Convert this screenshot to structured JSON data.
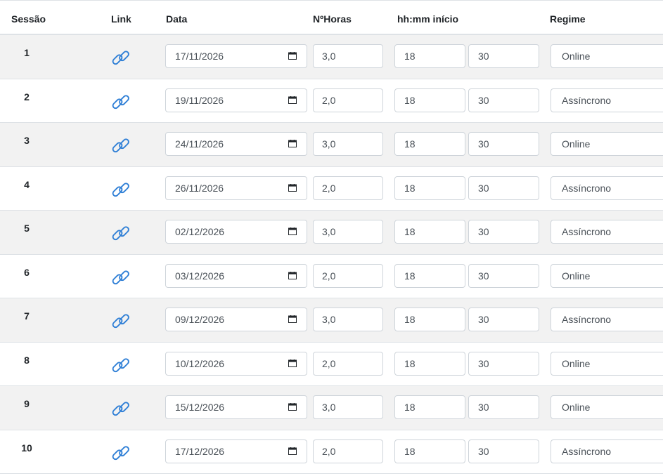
{
  "headers": {
    "sessao": "Sessão",
    "link": "Link",
    "data": "Data",
    "horas": "NºHoras",
    "inicio": "hh:mm início",
    "regime": "Regime"
  },
  "icons": {
    "link": "link-icon",
    "calendar": "calendar-icon"
  },
  "colors": {
    "link": "#2f7fd6",
    "stripe": "#f2f2f2"
  },
  "rows": [
    {
      "num": "1",
      "date": "17/11/2026",
      "hours": "3,0",
      "hh": "18",
      "mm": "30",
      "regime": "Online"
    },
    {
      "num": "2",
      "date": "19/11/2026",
      "hours": "2,0",
      "hh": "18",
      "mm": "30",
      "regime": "Assíncrono"
    },
    {
      "num": "3",
      "date": "24/11/2026",
      "hours": "3,0",
      "hh": "18",
      "mm": "30",
      "regime": "Online"
    },
    {
      "num": "4",
      "date": "26/11/2026",
      "hours": "2,0",
      "hh": "18",
      "mm": "30",
      "regime": "Assíncrono"
    },
    {
      "num": "5",
      "date": "02/12/2026",
      "hours": "3,0",
      "hh": "18",
      "mm": "30",
      "regime": "Assíncrono"
    },
    {
      "num": "6",
      "date": "03/12/2026",
      "hours": "2,0",
      "hh": "18",
      "mm": "30",
      "regime": "Online"
    },
    {
      "num": "7",
      "date": "09/12/2026",
      "hours": "3,0",
      "hh": "18",
      "mm": "30",
      "regime": "Assíncrono"
    },
    {
      "num": "8",
      "date": "10/12/2026",
      "hours": "2,0",
      "hh": "18",
      "mm": "30",
      "regime": "Online"
    },
    {
      "num": "9",
      "date": "15/12/2026",
      "hours": "3,0",
      "hh": "18",
      "mm": "30",
      "regime": "Online"
    },
    {
      "num": "10",
      "date": "17/12/2026",
      "hours": "2,0",
      "hh": "18",
      "mm": "30",
      "regime": "Assíncrono"
    }
  ]
}
